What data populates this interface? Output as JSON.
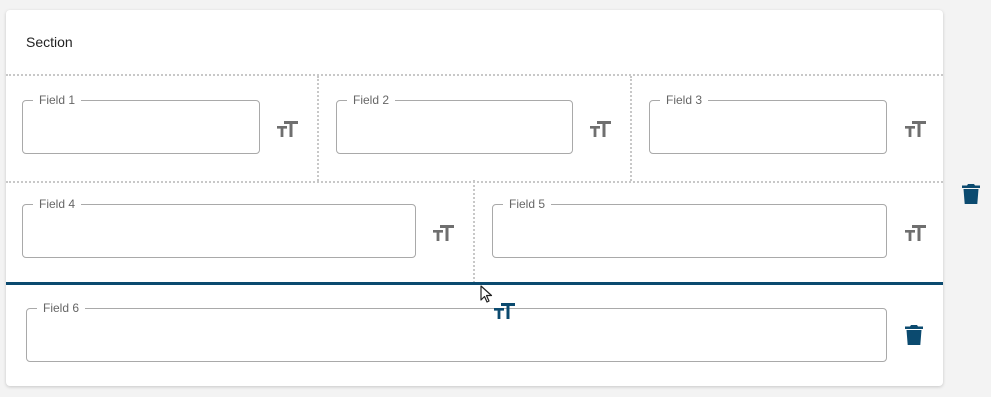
{
  "section": {
    "title": "Section"
  },
  "rows": [
    {
      "fields": [
        {
          "label": "Field 1"
        },
        {
          "label": "Field 2"
        },
        {
          "label": "Field 3"
        }
      ]
    },
    {
      "fields": [
        {
          "label": "Field 4"
        },
        {
          "label": "Field 5"
        }
      ]
    },
    {
      "fields": [
        {
          "label": "Field 6"
        }
      ]
    }
  ],
  "icons": {
    "text_size": "text-size-icon",
    "delete": "trash-icon",
    "grip": "drag-grip-icon",
    "cursor": "mouse-pointer-icon"
  },
  "colors": {
    "accent": "#0b4a6f",
    "icon_gray": "#6f6f6f",
    "dotted_border": "#c8c8c8",
    "field_border": "#a9a9a9"
  }
}
